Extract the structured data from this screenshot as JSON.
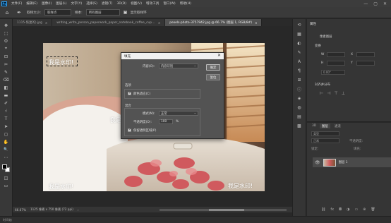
{
  "app": {
    "logo": "Ps",
    "menu": [
      "文件(F)",
      "编辑(E)",
      "图像(I)",
      "图层(L)",
      "文字(Y)",
      "选择(S)",
      "滤镜(T)",
      "3D(D)",
      "视图(V)",
      "增效工具",
      "窗口(W)",
      "帮助(H)"
    ],
    "window_controls": [
      "—",
      "▢",
      "✕"
    ]
  },
  "options_bar": {
    "size_label": "取样大小:",
    "size_value": "取样点",
    "sample_label": "样本:",
    "sample_value": "所有图层",
    "show_ring_label": "显示取样环"
  },
  "tabs": [
    {
      "label": "1115-恢复的).jpg",
      "active": false
    },
    {
      "label": "writing_write_person_paperwork_paper_notebook_coffee_cup_work-711313-恢复的).jpg",
      "active": false
    },
    {
      "label": "pexels-photo-3757942.jpg @ 66.7% (图层 1, RGB/8#)",
      "active": true
    }
  ],
  "tools": [
    "✥",
    "⬚",
    "ʘ",
    "⌖",
    "⊡",
    "✂",
    "✎",
    "⌫",
    "◧",
    "▬",
    "✐",
    "☝",
    "T",
    "➤",
    "◻",
    "✋",
    "🔍",
    "⋯"
  ],
  "canvas": {
    "watermarks": [
      "我是水印!",
      "我是水印!",
      "我是水印!",
      "我是水印!"
    ]
  },
  "dialog": {
    "title": "填充",
    "close": "✕",
    "content_label": "内容(O):",
    "content_value": "内容识别",
    "ok_label": "确定",
    "cancel_label": "复位",
    "options_group": "选项",
    "color_adapt_label": "颜色适应(C)",
    "blend_group": "混合",
    "mode_label": "模式(M):",
    "mode_value": "正常",
    "opacity_label": "不透明度(O):",
    "opacity_value": "100",
    "opacity_unit": "%",
    "preserve_label": "保留透明区域(P)"
  },
  "status": {
    "zoom": "66.67%",
    "size": "1125 像素 x 750 像素 (72 ppi)",
    "arrow": "›"
  },
  "bottom": {
    "timeline": "时间轴"
  },
  "properties_panel": {
    "tab": "属性",
    "pixel_layer": "像素图层",
    "transform": "变换",
    "align": "对齐并分布",
    "w_label": "W",
    "h_label": "H",
    "x_label": "X",
    "y_label": "Y",
    "angle_label": "0.00°"
  },
  "layers_panel": {
    "tabs": [
      "3D",
      "图层",
      "通道"
    ],
    "kind_label": "类型",
    "blend_value": "正常",
    "opacity_label": "不透明度:",
    "lock_label": "锁定:",
    "fill_label": "填充:",
    "layer_name": "图层 1"
  }
}
